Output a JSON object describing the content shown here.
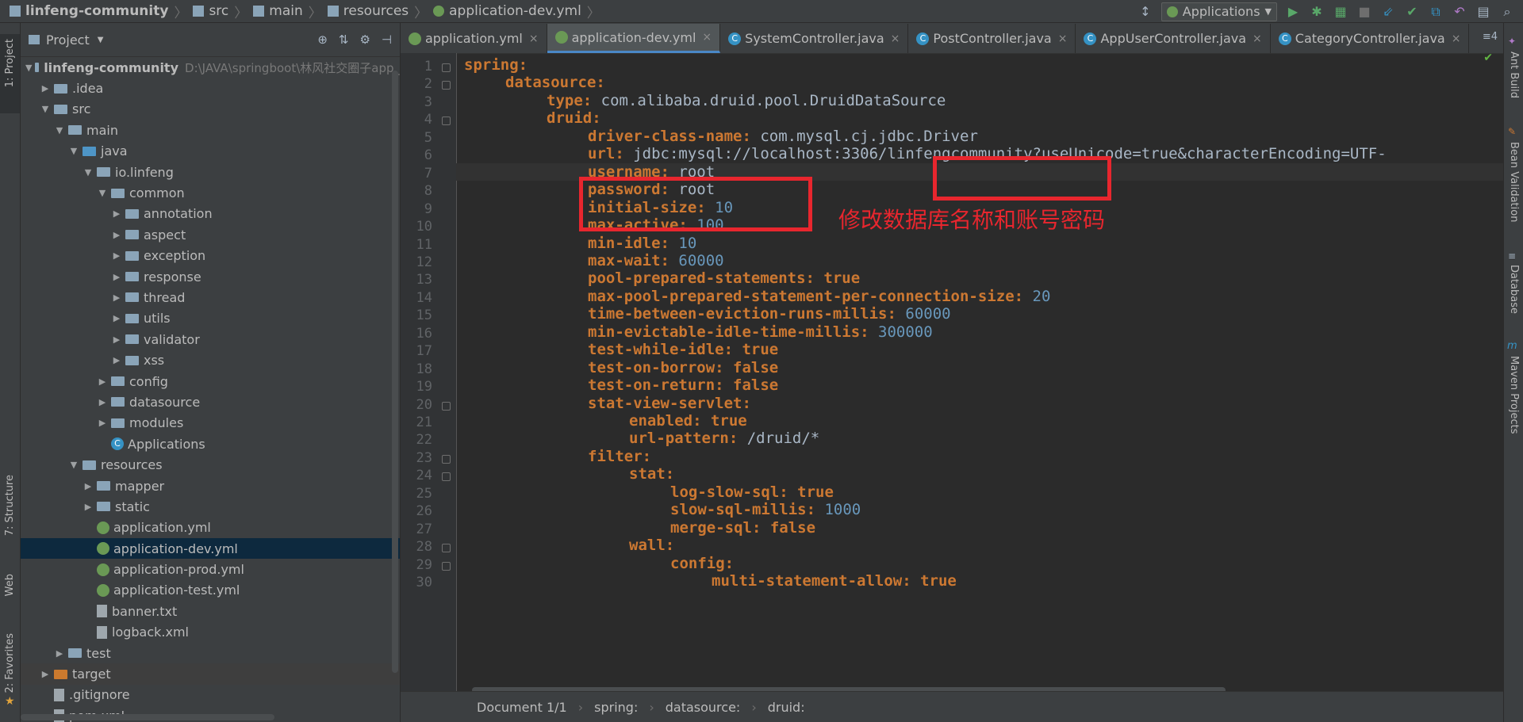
{
  "breadcrumbs": [
    "linfeng-community",
    "src",
    "main",
    "resources",
    "application-dev.yml"
  ],
  "run_config": "Applications",
  "left_tool_windows": [
    "1: Project",
    "7: Structure",
    "Web",
    "2: Favorites"
  ],
  "right_tool_windows": [
    "Ant Build",
    "Bean Validation",
    "Database",
    "Maven Projects"
  ],
  "project_panel": {
    "title": "Project",
    "tree": [
      {
        "label": "linfeng-community",
        "hint": "D:\\JAVA\\springboot\\林风社交圈子app_",
        "indent": 0,
        "arrow": "down",
        "icon": "folder"
      },
      {
        "label": ".idea",
        "indent": 1,
        "arrow": "right",
        "icon": "folder"
      },
      {
        "label": "src",
        "indent": 1,
        "arrow": "down",
        "icon": "folder"
      },
      {
        "label": "main",
        "indent": 2,
        "arrow": "down",
        "icon": "folder"
      },
      {
        "label": "java",
        "indent": 3,
        "arrow": "down",
        "icon": "folder-blue"
      },
      {
        "label": "io.linfeng",
        "indent": 4,
        "arrow": "down",
        "icon": "folder"
      },
      {
        "label": "common",
        "indent": 5,
        "arrow": "down",
        "icon": "folder"
      },
      {
        "label": "annotation",
        "indent": 6,
        "arrow": "right",
        "icon": "folder"
      },
      {
        "label": "aspect",
        "indent": 6,
        "arrow": "right",
        "icon": "folder"
      },
      {
        "label": "exception",
        "indent": 6,
        "arrow": "right",
        "icon": "folder"
      },
      {
        "label": "response",
        "indent": 6,
        "arrow": "right",
        "icon": "folder"
      },
      {
        "label": "thread",
        "indent": 6,
        "arrow": "right",
        "icon": "folder"
      },
      {
        "label": "utils",
        "indent": 6,
        "arrow": "right",
        "icon": "folder"
      },
      {
        "label": "validator",
        "indent": 6,
        "arrow": "right",
        "icon": "folder"
      },
      {
        "label": "xss",
        "indent": 6,
        "arrow": "right",
        "icon": "folder"
      },
      {
        "label": "config",
        "indent": 5,
        "arrow": "right",
        "icon": "folder"
      },
      {
        "label": "datasource",
        "indent": 5,
        "arrow": "right",
        "icon": "folder"
      },
      {
        "label": "modules",
        "indent": 5,
        "arrow": "right",
        "icon": "folder"
      },
      {
        "label": "Applications",
        "indent": 5,
        "arrow": "none",
        "icon": "class"
      },
      {
        "label": "resources",
        "indent": 3,
        "arrow": "down",
        "icon": "folder"
      },
      {
        "label": "mapper",
        "indent": 4,
        "arrow": "right",
        "icon": "folder"
      },
      {
        "label": "static",
        "indent": 4,
        "arrow": "right",
        "icon": "folder"
      },
      {
        "label": "application.yml",
        "indent": 4,
        "arrow": "none",
        "icon": "yml"
      },
      {
        "label": "application-dev.yml",
        "indent": 4,
        "arrow": "none",
        "icon": "yml",
        "selected": true
      },
      {
        "label": "application-prod.yml",
        "indent": 4,
        "arrow": "none",
        "icon": "yml"
      },
      {
        "label": "application-test.yml",
        "indent": 4,
        "arrow": "none",
        "icon": "yml"
      },
      {
        "label": "banner.txt",
        "indent": 4,
        "arrow": "none",
        "icon": "file"
      },
      {
        "label": "logback.xml",
        "indent": 4,
        "arrow": "none",
        "icon": "file"
      },
      {
        "label": "test",
        "indent": 2,
        "arrow": "right",
        "icon": "folder"
      },
      {
        "label": "target",
        "indent": 1,
        "arrow": "right",
        "icon": "folder-orange"
      },
      {
        "label": ".gitignore",
        "indent": 1,
        "arrow": "none",
        "icon": "file"
      },
      {
        "label": "pom.xml",
        "indent": 1,
        "arrow": "none",
        "icon": "file"
      }
    ]
  },
  "editor_tabs": [
    {
      "label": "application.yml",
      "icon": "yml"
    },
    {
      "label": "application-dev.yml",
      "icon": "yml",
      "active": true
    },
    {
      "label": "SystemController.java",
      "icon": "class"
    },
    {
      "label": "PostController.java",
      "icon": "class"
    },
    {
      "label": "AppUserController.java",
      "icon": "class"
    },
    {
      "label": "CategoryController.java",
      "icon": "class"
    }
  ],
  "tab_overflow": "≡4",
  "code_lines": [
    {
      "n": "1",
      "indent": 0,
      "key": "spring:",
      "val": "",
      "type": "none"
    },
    {
      "n": "2",
      "indent": 1,
      "key": "datasource:",
      "val": "",
      "type": "none"
    },
    {
      "n": "3",
      "indent": 2,
      "key": "type: ",
      "val": "com.alibaba.druid.pool.DruidDataSource",
      "type": "text"
    },
    {
      "n": "4",
      "indent": 2,
      "key": "druid:",
      "val": "",
      "type": "none"
    },
    {
      "n": "5",
      "indent": 3,
      "key": "driver-class-name: ",
      "val": "com.mysql.cj.jdbc.Driver",
      "type": "text"
    },
    {
      "n": "6",
      "indent": 3,
      "key": "url: ",
      "val": "jdbc:mysql://localhost:3306/linfengcommunity?useUnicode=true&characterEncoding=UTF-",
      "type": "text"
    },
    {
      "n": "7",
      "indent": 3,
      "key": "username: ",
      "val": "root",
      "type": "text"
    },
    {
      "n": "8",
      "indent": 3,
      "key": "password: ",
      "val": "root",
      "type": "text"
    },
    {
      "n": "9",
      "indent": 3,
      "key": "initial-size: ",
      "val": "10",
      "type": "num"
    },
    {
      "n": "10",
      "indent": 3,
      "key": "max-active: ",
      "val": "100",
      "type": "num"
    },
    {
      "n": "11",
      "indent": 3,
      "key": "min-idle: ",
      "val": "10",
      "type": "num"
    },
    {
      "n": "12",
      "indent": 3,
      "key": "max-wait: ",
      "val": "60000",
      "type": "num"
    },
    {
      "n": "13",
      "indent": 3,
      "key": "pool-prepared-statements: ",
      "val": "true",
      "type": "kw"
    },
    {
      "n": "14",
      "indent": 3,
      "key": "max-pool-prepared-statement-per-connection-size: ",
      "val": "20",
      "type": "num"
    },
    {
      "n": "15",
      "indent": 3,
      "key": "time-between-eviction-runs-millis: ",
      "val": "60000",
      "type": "num"
    },
    {
      "n": "16",
      "indent": 3,
      "key": "min-evictable-idle-time-millis: ",
      "val": "300000",
      "type": "num"
    },
    {
      "n": "17",
      "indent": 3,
      "key": "test-while-idle: ",
      "val": "true",
      "type": "kw"
    },
    {
      "n": "18",
      "indent": 3,
      "key": "test-on-borrow: ",
      "val": "false",
      "type": "kw"
    },
    {
      "n": "19",
      "indent": 3,
      "key": "test-on-return: ",
      "val": "false",
      "type": "kw"
    },
    {
      "n": "20",
      "indent": 3,
      "key": "stat-view-servlet:",
      "val": "",
      "type": "none"
    },
    {
      "n": "21",
      "indent": 4,
      "key": "enabled: ",
      "val": "true",
      "type": "kw"
    },
    {
      "n": "22",
      "indent": 4,
      "key": "url-pattern: ",
      "val": "/druid/*",
      "type": "text"
    },
    {
      "n": "23",
      "indent": 3,
      "key": "filter:",
      "val": "",
      "type": "none"
    },
    {
      "n": "24",
      "indent": 4,
      "key": "stat:",
      "val": "",
      "type": "none"
    },
    {
      "n": "25",
      "indent": 5,
      "key": "log-slow-sql: ",
      "val": "true",
      "type": "kw"
    },
    {
      "n": "26",
      "indent": 5,
      "key": "slow-sql-millis: ",
      "val": "1000",
      "type": "num"
    },
    {
      "n": "27",
      "indent": 5,
      "key": "merge-sql: ",
      "val": "false",
      "type": "kw"
    },
    {
      "n": "28",
      "indent": 4,
      "key": "wall:",
      "val": "",
      "type": "none"
    },
    {
      "n": "29",
      "indent": 5,
      "key": "config:",
      "val": "",
      "type": "none"
    },
    {
      "n": "30",
      "indent": 6,
      "key": "multi-statement-allow: ",
      "val": "true",
      "type": "kw"
    }
  ],
  "annotation_text": "修改数据库名称和账号密码",
  "status_bar": {
    "document": "Document 1/1",
    "path": [
      "spring:",
      "datasource:",
      "druid:"
    ]
  },
  "colors": {
    "annotation": "#e8262e",
    "key": "#cc7832",
    "number": "#6897bb",
    "text": "#a9b7c6"
  }
}
